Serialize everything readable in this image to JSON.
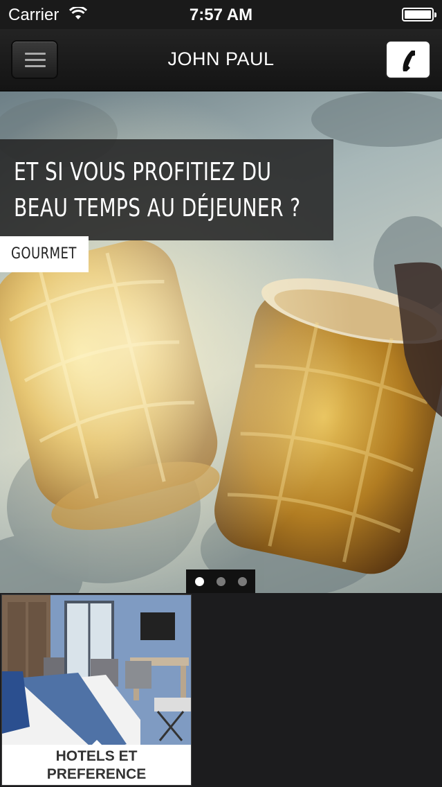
{
  "status_bar": {
    "carrier": "Carrier",
    "time": "7:57 AM",
    "wifi_icon": "wifi-icon",
    "battery_icon": "battery-icon"
  },
  "nav": {
    "title": "JOHN PAUL",
    "menu_icon": "hamburger-menu-icon",
    "phone_icon": "phone-icon"
  },
  "hero": {
    "headline_line1": "ET SI VOUS PROFITIEZ DU",
    "headline_line2": "BEAU TEMPS AU DÉJEUNER ?",
    "category": "GOURMET",
    "pager": {
      "total": 3,
      "active": 1
    }
  },
  "tiles": [
    {
      "label_line1": "HOTELS ET",
      "label_line2": "PREFERENCE"
    }
  ],
  "colors": {
    "background": "#1c1c1e",
    "headline_box": "#262626",
    "tag_background": "#ffffff"
  }
}
